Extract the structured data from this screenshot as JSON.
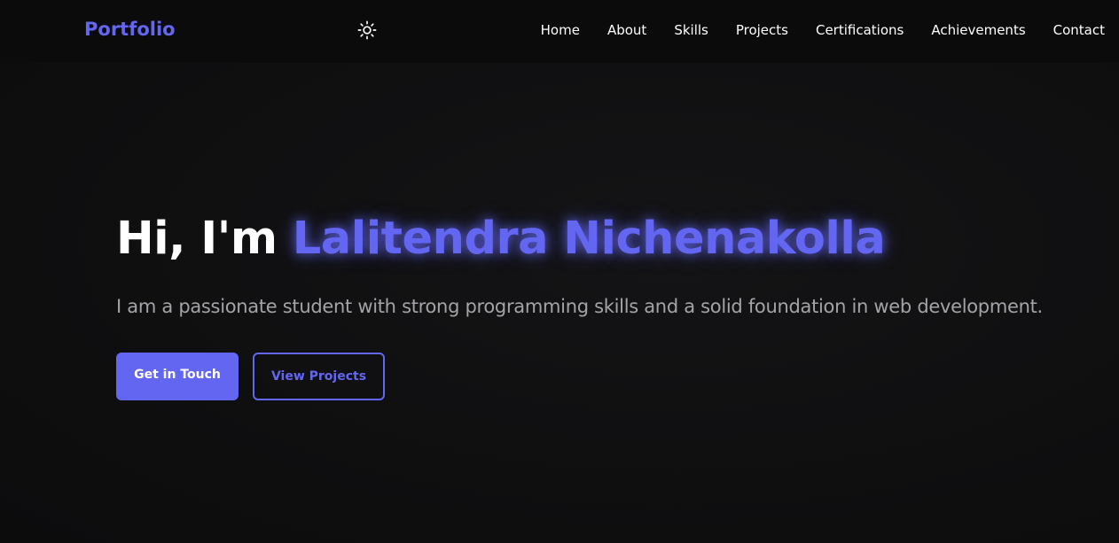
{
  "navbar": {
    "logo": "Portfolio",
    "theme_toggle_icon": "sun-icon",
    "links": [
      "Home",
      "About",
      "Skills",
      "Projects",
      "Certifications",
      "Achievements",
      "Contact"
    ]
  },
  "hero": {
    "greeting": "Hi, I'm",
    "name": "Lalitendra Nichenakolla",
    "subtitle": "I am a passionate student with strong programming skills and a solid foundation in web development.",
    "primary_button": "Get in Touch",
    "secondary_button": "View Projects"
  },
  "colors": {
    "accent": "#6366f1",
    "background": "#0f0f10",
    "navbar_background": "#0b0b0b",
    "text": "#ffffff",
    "subtitle_text": "#a3a3a8"
  }
}
